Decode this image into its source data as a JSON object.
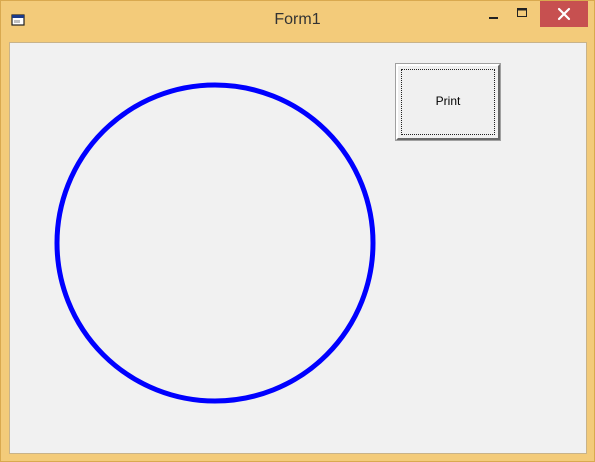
{
  "window": {
    "title": "Form1",
    "frame_color": "#f3cb7a",
    "close_color": "#c75050"
  },
  "titlebar_controls": {
    "minimize": "minimize-icon",
    "maximize": "maximize-icon",
    "close": "close-icon"
  },
  "form": {
    "print_button_label": "Print",
    "circle_color": "#0000ff"
  }
}
